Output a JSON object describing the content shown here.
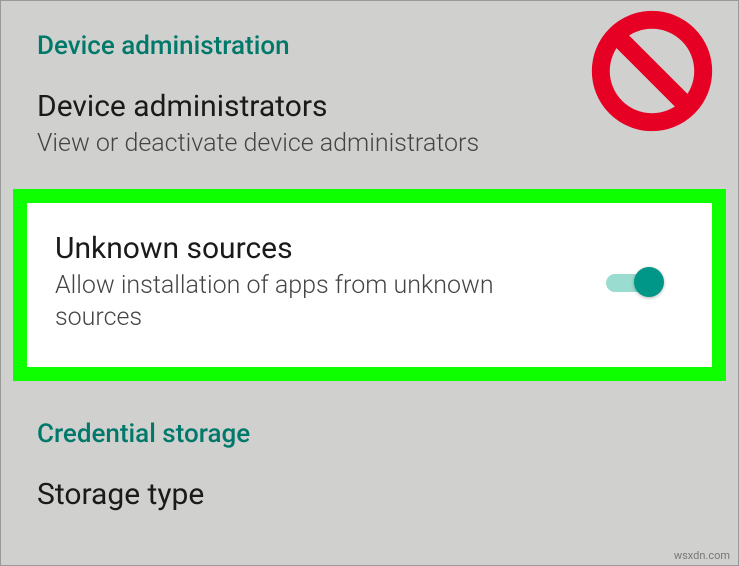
{
  "sections": {
    "device_admin_header": "Device administration",
    "credential_header": "Credential storage"
  },
  "items": {
    "device_administrators": {
      "title": "Device administrators",
      "subtitle": "View or deactivate device administrators"
    },
    "unknown_sources": {
      "title": "Unknown sources",
      "subtitle": "Allow installation of apps from unknown sources",
      "toggle_on": true
    },
    "storage_type": {
      "title": "Storage type"
    }
  },
  "colors": {
    "accent": "#00796b",
    "highlight_border": "#0dff00",
    "toggle_on": "#009688",
    "prohibit": "#e60023"
  },
  "watermark": "wsxdn.com"
}
